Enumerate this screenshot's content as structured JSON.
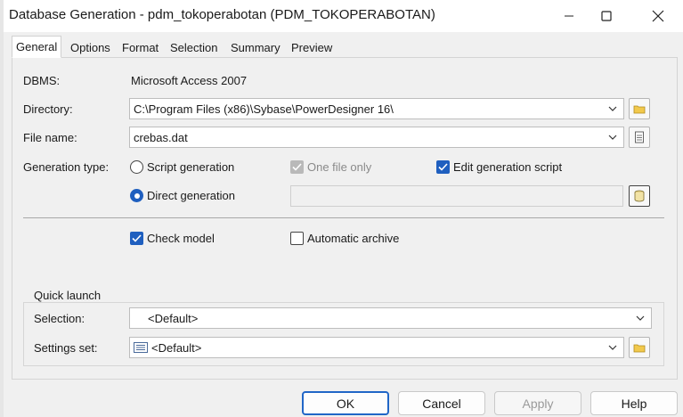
{
  "window": {
    "title": "Database Generation - pdm_tokoperabotan (PDM_TOKOPERABOTAN)"
  },
  "tabs": [
    {
      "label": "General",
      "active": true
    },
    {
      "label": "Options"
    },
    {
      "label": "Format"
    },
    {
      "label": "Selection"
    },
    {
      "label": "Summary"
    },
    {
      "label": "Preview"
    }
  ],
  "general": {
    "dbms_label": "DBMS:",
    "dbms_value": "Microsoft Access 2007",
    "directory_label": "Directory:",
    "directory_value": "C:\\Program Files (x86)\\Sybase\\PowerDesigner 16\\",
    "filename_label": "File name:",
    "filename_value": "crebas.dat",
    "generation_type_label": "Generation type:",
    "script_generation": "Script generation",
    "one_file_only": "One file only",
    "edit_generation_script": "Edit generation script",
    "direct_generation": "Direct generation",
    "check_model": "Check model",
    "automatic_archive": "Automatic archive"
  },
  "quick_launch": {
    "title": "Quick launch",
    "selection_label": "Selection:",
    "selection_value": "<Default>",
    "settings_label": "Settings set:",
    "settings_value": "<Default>"
  },
  "buttons": {
    "ok": "OK",
    "cancel": "Cancel",
    "apply": "Apply",
    "help": "Help"
  },
  "colors": {
    "accent": "#1f5fbf",
    "default_button_border": "#2166c7"
  }
}
